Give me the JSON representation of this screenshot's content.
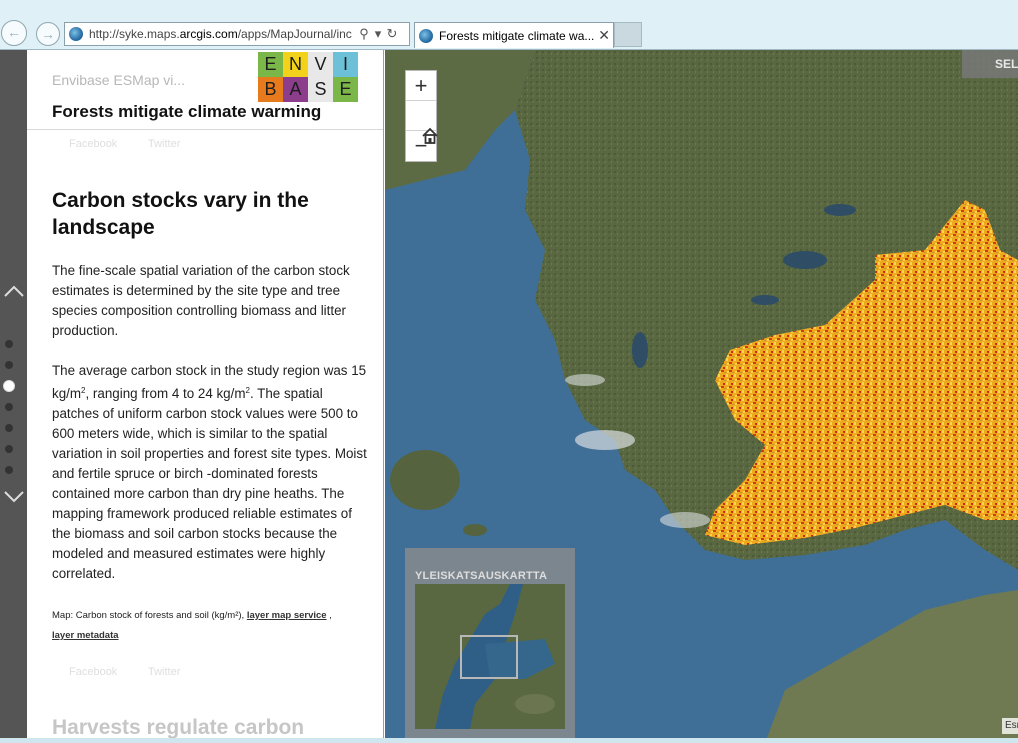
{
  "browser": {
    "url_prefix": "http://syke.maps.",
    "url_domain": "arcgis.com",
    "url_rest": "/apps/MapJournal/inc",
    "tab_title": "Forests mitigate climate wa..."
  },
  "panel": {
    "app_subtitle": "Envibase ESMap vi...",
    "app_title": "Forests mitigate climate warming",
    "logo_letters": [
      "E",
      "N",
      "V",
      "I",
      "B",
      "A",
      "S",
      "E"
    ],
    "logo_colors": [
      "#7ab648",
      "#f2d21a",
      "#e8e8e8",
      "#6cc0d8",
      "#e87a1e",
      "#8c3d8c",
      "#e8e8e8",
      "#7ab648"
    ],
    "share_facebook": "Facebook",
    "share_twitter": "Twitter",
    "section_heading": "Carbon stocks vary in the landscape",
    "para1": "The fine-scale spatial variation of the carbon stock estimates is determined by the site type and tree species composition controlling biomass and litter production.",
    "para2_a": "The average carbon stock in the study region was 15 kg/m",
    "para2_sup1": "2",
    "para2_b": ", ranging from 4 to 24 kg/m",
    "para2_sup2": "2",
    "para2_c": ". The spatial patches of uniform carbon stock values were 500 to 600 meters wide, which is similar to the spatial variation in soil properties and forest site types. Moist and fertile spruce or birch -dominated forests contained more carbon than dry pine heaths. The mapping framework produced reliable estimates of the biomass and soil carbon stocks because the modeled and measured estimates were highly correlated.",
    "caption_text": "Map: Carbon stock of forests and soil (kg/m²), ",
    "caption_link1": "layer map service",
    "caption_sep": " ,",
    "caption_link2": "layer metadata",
    "next_heading": "Harvests regulate carbon"
  },
  "nav": {
    "up_glyph": "⌃",
    "down_glyph": "⌄",
    "section_count": 7,
    "active_section": 3
  },
  "map": {
    "zoom_in": "+",
    "zoom_out": "−",
    "select_label": "SELECT",
    "overview_title": "YLEISKATSAUSKARTTA",
    "attribution": "Esri"
  },
  "colors": {
    "water": "#3f6f96",
    "land": "#5f6b45",
    "carbon_high": "#d23a18",
    "carbon_mid": "#f0a81e",
    "carbon_low": "#f7d64a"
  }
}
